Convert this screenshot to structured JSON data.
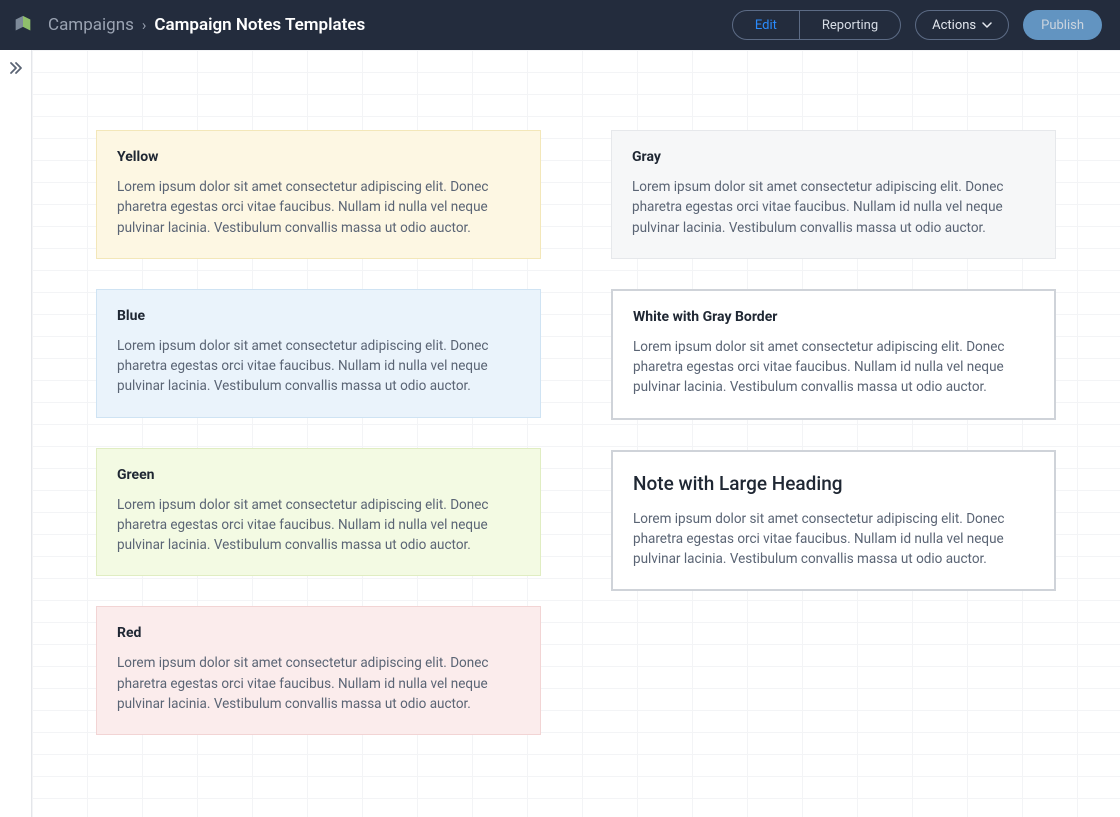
{
  "header": {
    "breadcrumb_root": "Campaigns",
    "breadcrumb_sep": "›",
    "breadcrumb_current": "Campaign Notes Templates",
    "edit_label": "Edit",
    "reporting_label": "Reporting",
    "actions_label": "Actions",
    "publish_label": "Publish"
  },
  "lorem": "Lorem ipsum dolor sit amet consectetur adipiscing elit. Donec pharetra egestas orci vitae faucibus. Nullam id nulla vel neque pulvinar lacinia. Vestibulum convallis massa ut odio auctor.",
  "notes_left": [
    {
      "title": "Yellow",
      "theme": "yellow"
    },
    {
      "title": "Blue",
      "theme": "blue"
    },
    {
      "title": "Green",
      "theme": "green"
    },
    {
      "title": "Red",
      "theme": "red"
    }
  ],
  "notes_right": [
    {
      "title": "Gray",
      "theme": "gray"
    },
    {
      "title": "White with Gray Border",
      "theme": "white-border"
    },
    {
      "title": "Note with Large Heading",
      "theme": "large-heading",
      "large_heading": true
    }
  ]
}
